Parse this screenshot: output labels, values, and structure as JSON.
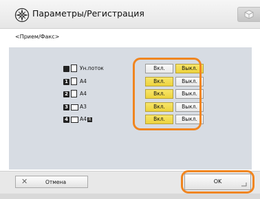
{
  "header": {
    "title": "Параметры/Регистрация",
    "logo_icon": "settings-registration-icon",
    "corner_icon": "cube-icon"
  },
  "subtitle": "<Прием/Факс>",
  "rows": [
    {
      "num": "",
      "icon": "paper-drawer-icon",
      "label": "Ун.поток",
      "badge": "",
      "on_label": "Вкл.",
      "off_label": "Выкл.",
      "active": "off"
    },
    {
      "num": "1",
      "icon": "paper-drawer-icon",
      "label": "A4",
      "badge": "",
      "on_label": "Вкл.",
      "off_label": "Выкл.",
      "active": "on"
    },
    {
      "num": "2",
      "icon": "paper-drawer-icon",
      "label": "A4",
      "badge": "",
      "on_label": "Вкл.",
      "off_label": "Выкл.",
      "active": "on"
    },
    {
      "num": "3",
      "icon": "paper-drawer-icon",
      "label": "A3",
      "badge": "",
      "on_label": "Вкл.",
      "off_label": "Выкл.",
      "active": "on"
    },
    {
      "num": "4",
      "icon": "paper-drawer-icon",
      "label": "A4",
      "badge": "R",
      "on_label": "Вкл.",
      "off_label": "Выкл.",
      "active": "on"
    }
  ],
  "footer": {
    "cancel_label": "Отмена",
    "cancel_icon": "close-icon",
    "ok_label": "OK"
  },
  "colors": {
    "highlight": "#f0851f",
    "active_toggle": "#f2dc4f",
    "panel": "#d7dce3"
  }
}
